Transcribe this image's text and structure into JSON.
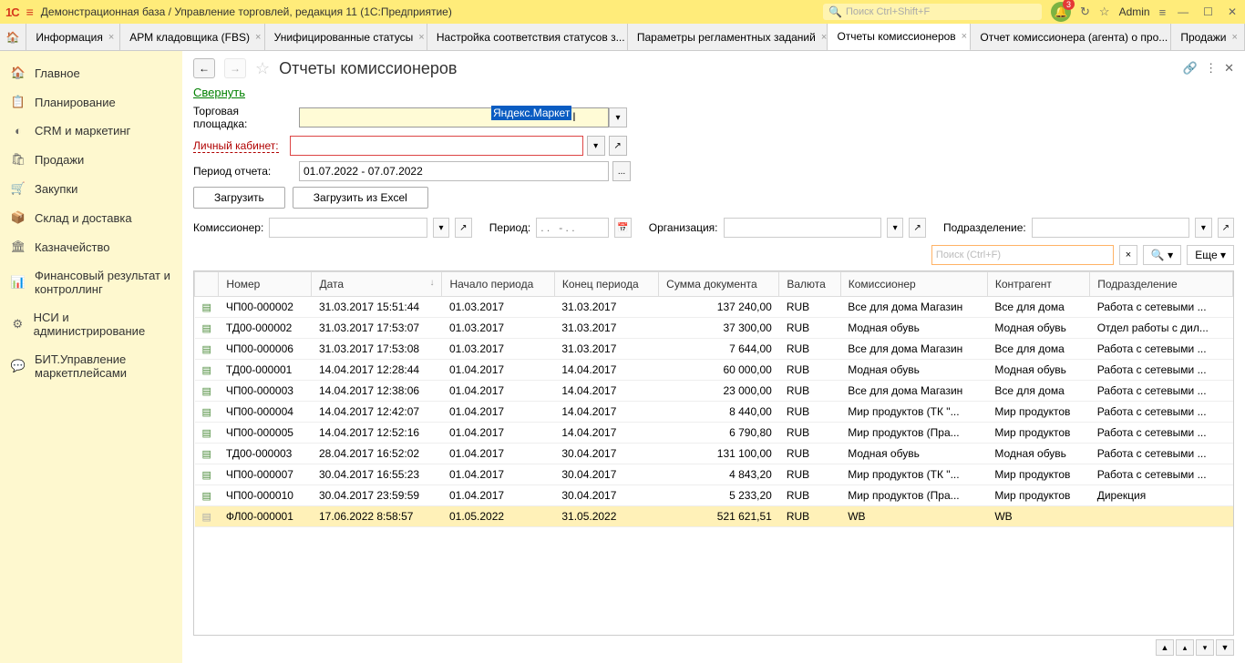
{
  "titlebar": {
    "logo": "1С",
    "title": "Демонстрационная база / Управление торговлей, редакция 11  (1С:Предприятие)",
    "search_placeholder": "Поиск Ctrl+Shift+F",
    "bell_badge": "3",
    "user": "Admin"
  },
  "tabs": [
    {
      "label": "Информация"
    },
    {
      "label": "АРМ кладовщика (FBS)"
    },
    {
      "label": "Унифицированные статусы"
    },
    {
      "label": "Настройка соответствия статусов з..."
    },
    {
      "label": "Параметры регламентных заданий"
    },
    {
      "label": "Отчеты комиссионеров",
      "active": true
    },
    {
      "label": "Отчет комиссионера (агента) о про..."
    },
    {
      "label": "Продажи"
    }
  ],
  "sidebar": [
    {
      "icon": "🏠",
      "label": "Главное"
    },
    {
      "icon": "📋",
      "label": "Планирование"
    },
    {
      "icon": "◐",
      "label": "CRM и маркетинг"
    },
    {
      "icon": "🛍",
      "label": "Продажи"
    },
    {
      "icon": "🛒",
      "label": "Закупки"
    },
    {
      "icon": "📦",
      "label": "Склад и доставка"
    },
    {
      "icon": "🏛",
      "label": "Казначейство"
    },
    {
      "icon": "📊",
      "label": "Финансовый результат и контроллинг"
    },
    {
      "icon": "⚙",
      "label": "НСИ и администрирование"
    },
    {
      "icon": "💬",
      "label": "БИТ.Управление маркетплейсами"
    }
  ],
  "page": {
    "title": "Отчеты комиссионеров",
    "collapse": "Свернуть",
    "marketplace_label": "Торговая площадка:",
    "marketplace_value": "Яндекс.Маркет",
    "account_label": "Личный кабинет:",
    "period_label": "Период отчета:",
    "period_value": "01.07.2022 - 07.07.2022",
    "load_btn": "Загрузить",
    "load_excel_btn": "Загрузить из Excel",
    "commissioner_label": "Комиссионер:",
    "date_filter_label": "Период:",
    "date_filter_placeholder": ". .   - . .",
    "org_label": "Организация:",
    "dept_label": "Подразделение:",
    "search_placeholder": "Поиск (Ctrl+F)",
    "more_btn": "Еще"
  },
  "columns": [
    "Номер",
    "Дата",
    "Начало периода",
    "Конец периода",
    "Сумма документа",
    "Валюта",
    "Комиссионер",
    "Контрагент",
    "Подразделение"
  ],
  "rows": [
    {
      "st": "g",
      "num": "ЧП00-000002",
      "date": "31.03.2017 15:51:44",
      "s": "01.03.2017",
      "e": "31.03.2017",
      "sum": "137 240,00",
      "cur": "RUB",
      "com": "Все для дома Магазин",
      "ctr": "Все для дома",
      "dep": "Работа с сетевыми ..."
    },
    {
      "st": "g",
      "num": "ТД00-000002",
      "date": "31.03.2017 17:53:07",
      "s": "01.03.2017",
      "e": "31.03.2017",
      "sum": "37 300,00",
      "cur": "RUB",
      "com": "Модная обувь",
      "ctr": "Модная обувь",
      "dep": "Отдел работы с дил..."
    },
    {
      "st": "g",
      "num": "ЧП00-000006",
      "date": "31.03.2017 17:53:08",
      "s": "01.03.2017",
      "e": "31.03.2017",
      "sum": "7 644,00",
      "cur": "RUB",
      "com": "Все для дома Магазин",
      "ctr": "Все для дома",
      "dep": "Работа с сетевыми ..."
    },
    {
      "st": "g",
      "num": "ТД00-000001",
      "date": "14.04.2017 12:28:44",
      "s": "01.04.2017",
      "e": "14.04.2017",
      "sum": "60 000,00",
      "cur": "RUB",
      "com": "Модная обувь",
      "ctr": "Модная обувь",
      "dep": "Работа с сетевыми ..."
    },
    {
      "st": "g",
      "num": "ЧП00-000003",
      "date": "14.04.2017 12:38:06",
      "s": "01.04.2017",
      "e": "14.04.2017",
      "sum": "23 000,00",
      "cur": "RUB",
      "com": "Все для дома Магазин",
      "ctr": "Все для дома",
      "dep": "Работа с сетевыми ..."
    },
    {
      "st": "g",
      "num": "ЧП00-000004",
      "date": "14.04.2017 12:42:07",
      "s": "01.04.2017",
      "e": "14.04.2017",
      "sum": "8 440,00",
      "cur": "RUB",
      "com": "Мир продуктов (ТК \"...",
      "ctr": "Мир продуктов",
      "dep": "Работа с сетевыми ..."
    },
    {
      "st": "g",
      "num": "ЧП00-000005",
      "date": "14.04.2017 12:52:16",
      "s": "01.04.2017",
      "e": "14.04.2017",
      "sum": "6 790,80",
      "cur": "RUB",
      "com": "Мир продуктов (Пра...",
      "ctr": "Мир продуктов",
      "dep": "Работа с сетевыми ..."
    },
    {
      "st": "g",
      "num": "ТД00-000003",
      "date": "28.04.2017 16:52:02",
      "s": "01.04.2017",
      "e": "30.04.2017",
      "sum": "131 100,00",
      "cur": "RUB",
      "com": "Модная обувь",
      "ctr": "Модная обувь",
      "dep": "Работа с сетевыми ..."
    },
    {
      "st": "g",
      "num": "ЧП00-000007",
      "date": "30.04.2017 16:55:23",
      "s": "01.04.2017",
      "e": "30.04.2017",
      "sum": "4 843,20",
      "cur": "RUB",
      "com": "Мир продуктов (ТК \"...",
      "ctr": "Мир продуктов",
      "dep": "Работа с сетевыми ..."
    },
    {
      "st": "g",
      "num": "ЧП00-000010",
      "date": "30.04.2017 23:59:59",
      "s": "01.04.2017",
      "e": "30.04.2017",
      "sum": "5 233,20",
      "cur": "RUB",
      "com": "Мир продуктов (Пра...",
      "ctr": "Мир продуктов",
      "dep": "Дирекция"
    },
    {
      "st": "x",
      "num": "ФЛ00-000001",
      "date": "17.06.2022 8:58:57",
      "s": "01.05.2022",
      "e": "31.05.2022",
      "sum": "521 621,51",
      "cur": "RUB",
      "com": "WB",
      "ctr": "WB",
      "dep": "",
      "sel": true
    }
  ]
}
